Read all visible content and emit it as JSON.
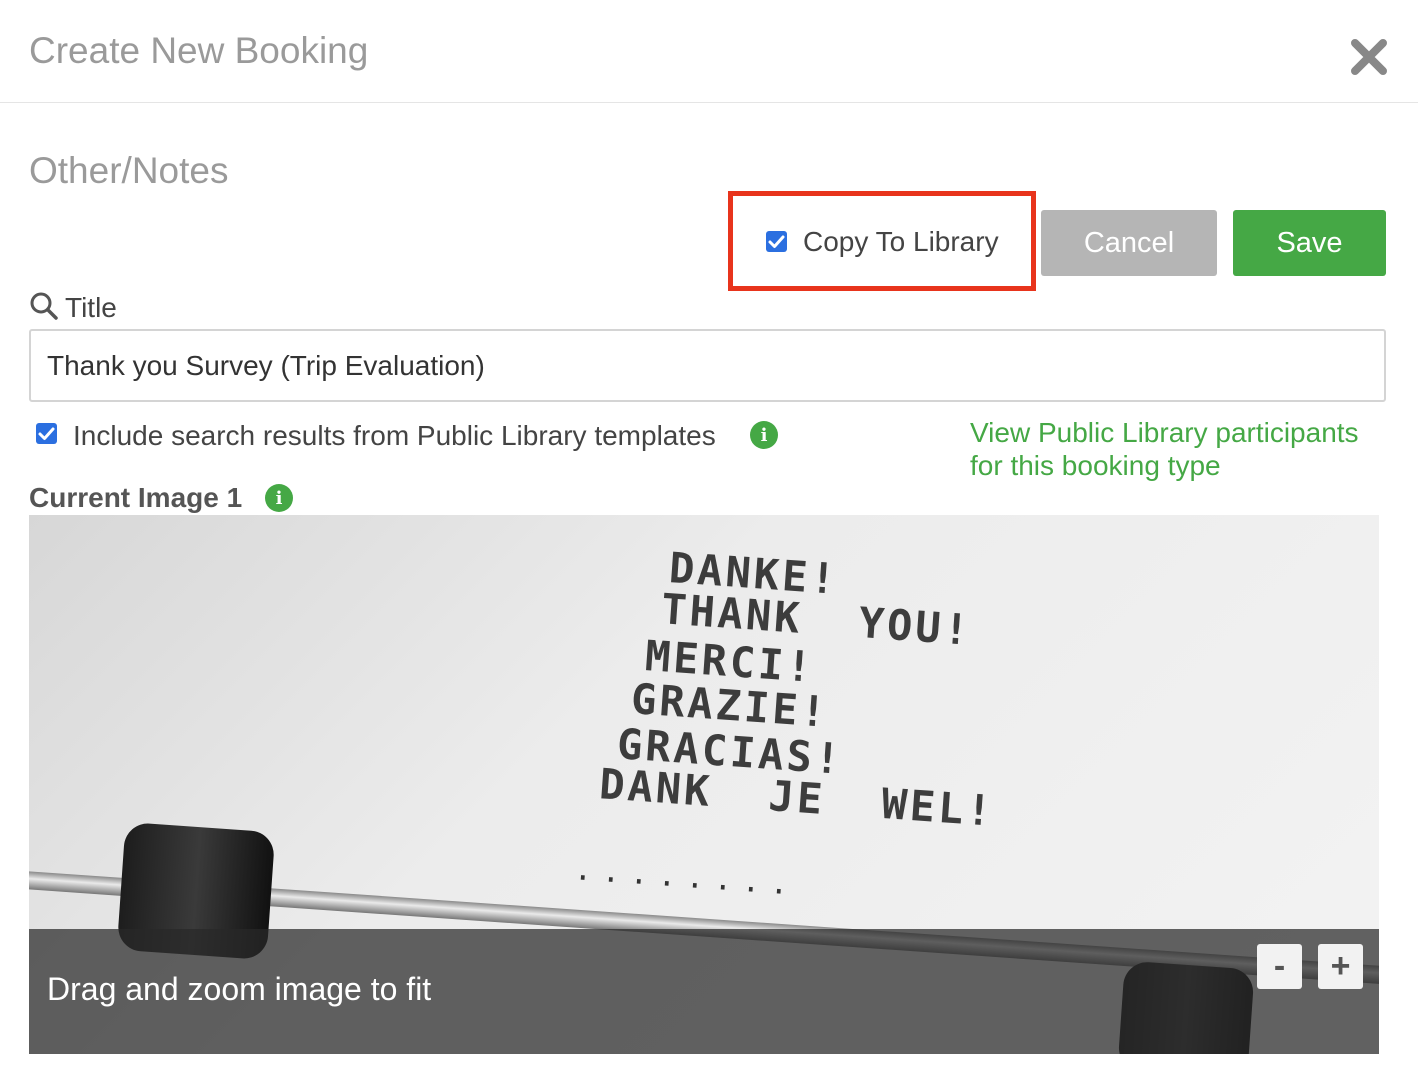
{
  "header": {
    "title": "Create New Booking",
    "close_icon": "close-icon"
  },
  "section": {
    "title": "Other/Notes"
  },
  "actions": {
    "copy_to_library_label": "Copy To Library",
    "copy_to_library_checked": true,
    "cancel_label": "Cancel",
    "save_label": "Save",
    "highlight_color": "#e8341c",
    "save_color": "#45a845",
    "cancel_color": "#b5b5b5"
  },
  "title_field": {
    "label": "Title",
    "icon": "search-icon",
    "value": "Thank you Survey (Trip Evaluation)"
  },
  "include_public": {
    "label": "Include search results from Public Library templates",
    "checked": true,
    "info_icon": "info-icon"
  },
  "public_link": {
    "line1": "View Public Library participants",
    "line2": "for this booking type",
    "color": "#45a845"
  },
  "image": {
    "label": "Current Image 1",
    "info_icon": "info-icon",
    "typed_lines": [
      "DANKE!",
      "THANK  YOU!",
      "MERCI!",
      "GRAZIE!",
      "GRACIAS!",
      "DANK  JE  WEL!"
    ],
    "dots": "........",
    "overlay_text": "Drag and zoom image to fit",
    "zoom_out_label": "-",
    "zoom_in_label": "+"
  }
}
